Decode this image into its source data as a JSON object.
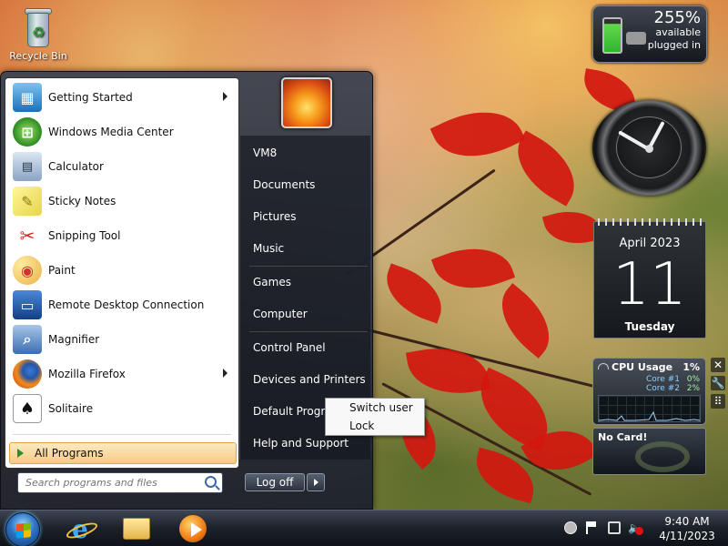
{
  "desktop": {
    "recycle_bin_label": "Recycle Bin"
  },
  "start_menu": {
    "programs": [
      {
        "label": "Getting Started",
        "icon": "getting-started-icon",
        "has_submenu": true
      },
      {
        "label": "Windows Media Center",
        "icon": "media-center-icon",
        "has_submenu": false
      },
      {
        "label": "Calculator",
        "icon": "calculator-icon",
        "has_submenu": false
      },
      {
        "label": "Sticky Notes",
        "icon": "sticky-notes-icon",
        "has_submenu": false
      },
      {
        "label": "Snipping Tool",
        "icon": "snipping-tool-icon",
        "has_submenu": false
      },
      {
        "label": "Paint",
        "icon": "paint-icon",
        "has_submenu": false
      },
      {
        "label": "Remote Desktop Connection",
        "icon": "remote-desktop-icon",
        "has_submenu": false
      },
      {
        "label": "Magnifier",
        "icon": "magnifier-icon",
        "has_submenu": false
      },
      {
        "label": "Mozilla Firefox",
        "icon": "firefox-icon",
        "has_submenu": true
      },
      {
        "label": "Solitaire",
        "icon": "solitaire-icon",
        "has_submenu": false
      }
    ],
    "all_programs": "All Programs",
    "search_placeholder": "Search programs and files",
    "right_links": [
      "VM8",
      "Documents",
      "Pictures",
      "Music",
      "Games",
      "Computer",
      "Control Panel",
      "Devices and Printers",
      "Default Programs",
      "Help and Support"
    ],
    "logoff_label": "Log off",
    "power_submenu": [
      "Switch user",
      "Lock"
    ]
  },
  "gadgets": {
    "battery": {
      "percent": "255%",
      "status1": "available",
      "status2": "plugged in"
    },
    "calendar": {
      "month_year": "April 2023",
      "day": "11",
      "weekday": "Tuesday"
    },
    "cpu": {
      "title": "CPU Usage",
      "total": "1%",
      "core1_label": "Core #1",
      "core1_value": "0%",
      "core2_label": "Core #2",
      "core2_value": "2%"
    },
    "gpu": {
      "title": "No Card!"
    }
  },
  "taskbar": {
    "time": "9:40 AM",
    "date": "4/11/2023",
    "pinned": [
      "internet-explorer-icon",
      "windows-explorer-icon",
      "windows-media-player-icon"
    ]
  },
  "colors": {
    "accent_orange": "#f6cb82",
    "start_menu_dark": "#1e222c",
    "leaf_red": "#d3170f"
  }
}
